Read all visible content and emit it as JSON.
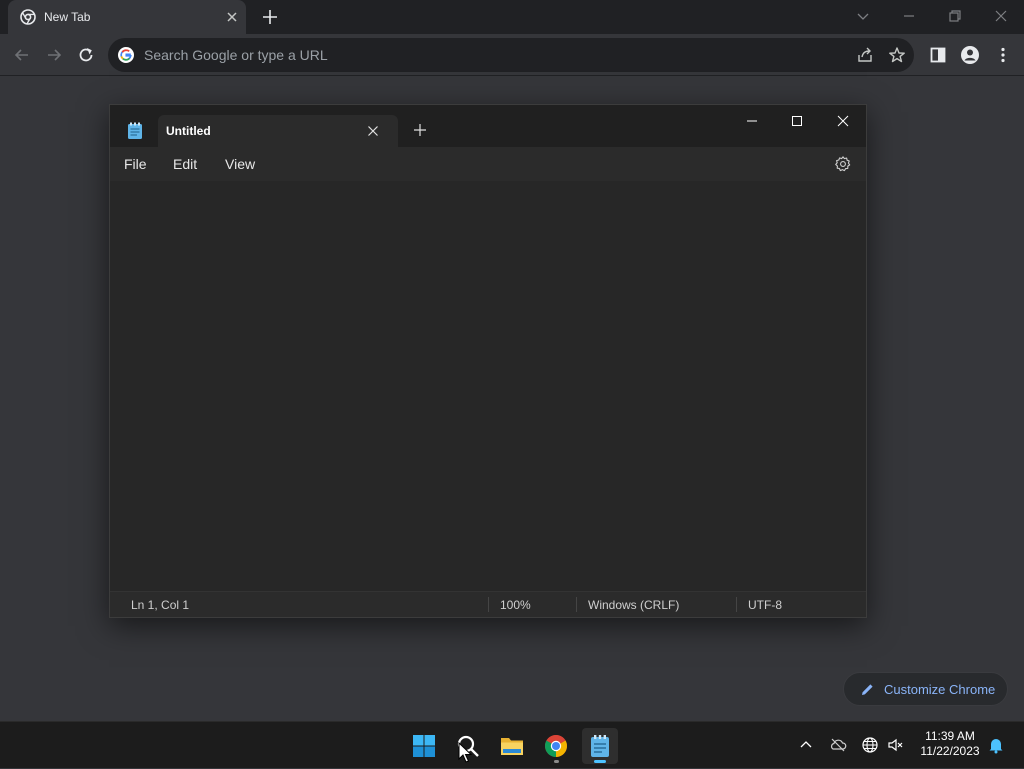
{
  "browser": {
    "tab": {
      "title": "New Tab"
    },
    "omnibox": {
      "placeholder": "Search Google or type a URL"
    },
    "customize_label": "Customize Chrome"
  },
  "notepad": {
    "tab_title": "Untitled",
    "menu": [
      "File",
      "Edit",
      "View"
    ],
    "status": {
      "position": "Ln 1, Col 1",
      "zoom": "100%",
      "line_ending": "Windows (CRLF)",
      "encoding": "UTF-8"
    }
  },
  "taskbar": {
    "apps": [
      "start-icon",
      "search-icon",
      "file-explorer-icon",
      "chrome-icon",
      "notepad-icon"
    ],
    "clock": {
      "time": "11:39 AM",
      "date": "11/22/2023"
    }
  },
  "colors": {
    "accent": "#8ab4f8",
    "taskbar_active": "#4cc2ff",
    "chrome_bg": "#35363a"
  }
}
